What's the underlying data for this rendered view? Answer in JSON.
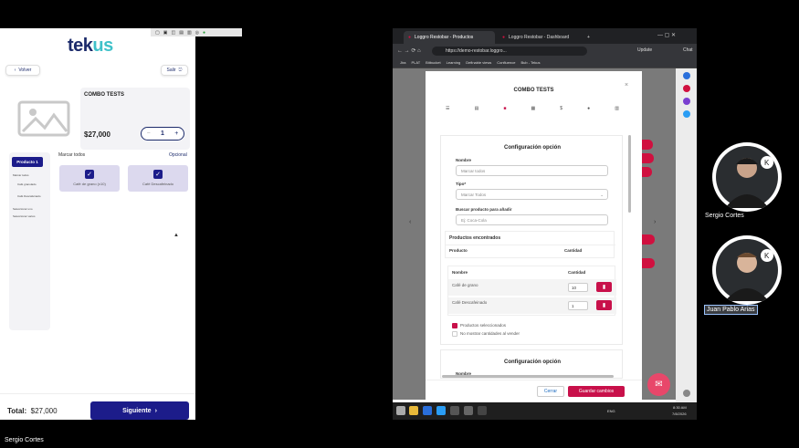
{
  "left_app": {
    "logo_a": "tek",
    "logo_b": "us",
    "back_label": "Volver",
    "exit_label": "Salir",
    "product_name": "COMBO TESTS",
    "price": "$27,000",
    "qty_minus": "−",
    "qty_value": "1",
    "qty_plus": "+",
    "sidebar_active": "Producto 1",
    "sidebar_items": [
      "Marcar todos",
      "Café granulado",
      "Café Descafeinado",
      "Seleccionar uno",
      "Seleccionar varios"
    ],
    "marcar_todos": "Marcar todos",
    "opcional": "Opcional",
    "options": [
      "Café de grano (x10)",
      "Café Descafeinado"
    ],
    "total_label": "Total:",
    "total_value": "$27,000",
    "next_label": "Siguiente"
  },
  "browser": {
    "tabs": [
      "Loggro Restobar - Productos",
      "Loggro Restobar - Dashboard"
    ],
    "new_tab": "+",
    "url": "https://demo-restobar.loggro...",
    "bookmarks": [
      "Jira",
      "PLAT",
      "Bitbucket",
      "Learning",
      "Definable views",
      "Confluence",
      "Bub - Tekus"
    ],
    "update_label": "Update",
    "chat_label": "Chat"
  },
  "modal": {
    "title": "COMBO TESTS",
    "close": "×",
    "config1": {
      "title": "Configuración opción",
      "nombre_label": "Nombre",
      "nombre_value": "Marcar todos",
      "tipo_label": "Tipo*",
      "tipo_value": "Marcar Todos",
      "buscar_label": "Buscar producto para añadir",
      "buscar_placeholder": "Ej: Coca-Cola",
      "found_header": "Productos encontrados",
      "found_cols": [
        "Producto",
        "Cantidad"
      ],
      "table_cols": [
        "Nombre",
        "Cantidad"
      ],
      "rows": [
        {
          "name": "Café de grano",
          "qty": "10"
        },
        {
          "name": "Café Descafeinado",
          "qty": "1"
        }
      ],
      "check1": "Productos seleccionados",
      "check2": "No mostrar cantidades al vender"
    },
    "config2": {
      "title": "Configuración opción",
      "nombre_label": "Nombre"
    },
    "cancel": "Cerrar",
    "save": "Guardar cambios"
  },
  "taskbar": {
    "lang": "ENG",
    "time": "8:30 AM",
    "date": "7/8/2026"
  },
  "participants": {
    "p1": "Sergio Cortes",
    "p2": "Juan Pablo Arias",
    "self": "Sergio Cortes"
  },
  "colors": {
    "brand": "#1c1c8a",
    "accent": "#c8104a",
    "teal": "#3fc1c9"
  }
}
